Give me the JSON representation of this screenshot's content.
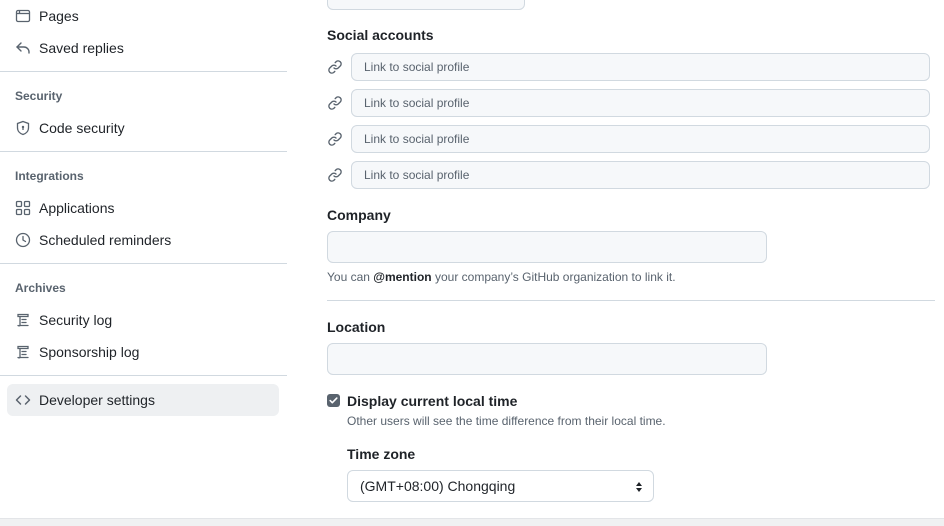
{
  "sidebar": {
    "items": [
      {
        "label": "Pages",
        "icon": "browser-icon"
      },
      {
        "label": "Saved replies",
        "icon": "reply-icon"
      }
    ],
    "sections": [
      {
        "title": "Security",
        "items": [
          {
            "label": "Code security",
            "icon": "shield-lock-icon"
          }
        ]
      },
      {
        "title": "Integrations",
        "items": [
          {
            "label": "Applications",
            "icon": "apps-icon"
          },
          {
            "label": "Scheduled reminders",
            "icon": "clock-icon"
          }
        ]
      },
      {
        "title": "Archives",
        "items": [
          {
            "label": "Security log",
            "icon": "log-icon"
          },
          {
            "label": "Sponsorship log",
            "icon": "log-icon"
          }
        ]
      }
    ],
    "developer": {
      "label": "Developer settings",
      "icon": "code-icon"
    }
  },
  "form": {
    "social": {
      "label": "Social accounts",
      "placeholders": [
        "Link to social profile",
        "Link to social profile",
        "Link to social profile",
        "Link to social profile"
      ]
    },
    "company": {
      "label": "Company",
      "value": "",
      "note_prefix": "You can ",
      "note_mention": "@mention",
      "note_suffix": " your company’s GitHub organization to link it."
    },
    "location": {
      "label": "Location",
      "value": ""
    },
    "local_time": {
      "label": "Display current local time",
      "checked": true,
      "note": "Other users will see the time difference from their local time."
    },
    "timezone": {
      "label": "Time zone",
      "value": "(GMT+08:00) Chongqing"
    }
  },
  "colors": {
    "active_bg": "#eef0f2",
    "border": "#d1d9e0",
    "muted": "#59636e",
    "text": "#1f2328"
  }
}
